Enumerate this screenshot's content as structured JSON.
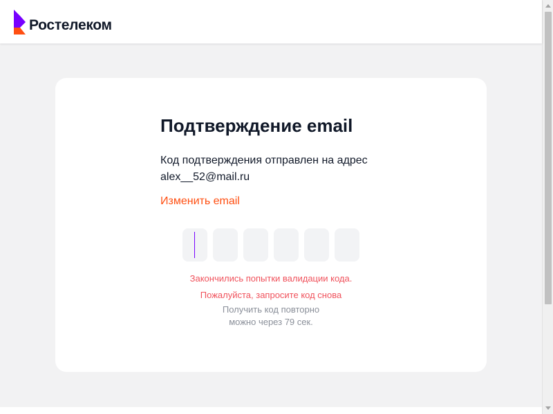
{
  "header": {
    "brand_name": "Ростелеком",
    "logo_colors": {
      "primary": "#7700ff",
      "accent": "#ff4f12"
    }
  },
  "confirm": {
    "title": "Подтверждение email",
    "description_line1": "Код подтверждения отправлен на адрес",
    "email": "alex__52@mail.ru",
    "change_email_link": "Изменить email",
    "code_cells": [
      "",
      "",
      "",
      "",
      "",
      ""
    ],
    "error_line1": "Закончились попытки валидации кода.",
    "error_line2": "Пожалуйста, запросите код снова",
    "resend_line1": "Получить код повторно",
    "resend_line2": "можно через 79 сек."
  },
  "colors": {
    "link": "#ff4f12",
    "error": "#f0515b",
    "muted": "#8a8f99",
    "caret": "#7700ff"
  },
  "icons": {
    "logo": "rostelecom-logo-icon",
    "scroll_up": "scroll-up-arrow-icon",
    "scroll_down": "scroll-down-arrow-icon"
  }
}
